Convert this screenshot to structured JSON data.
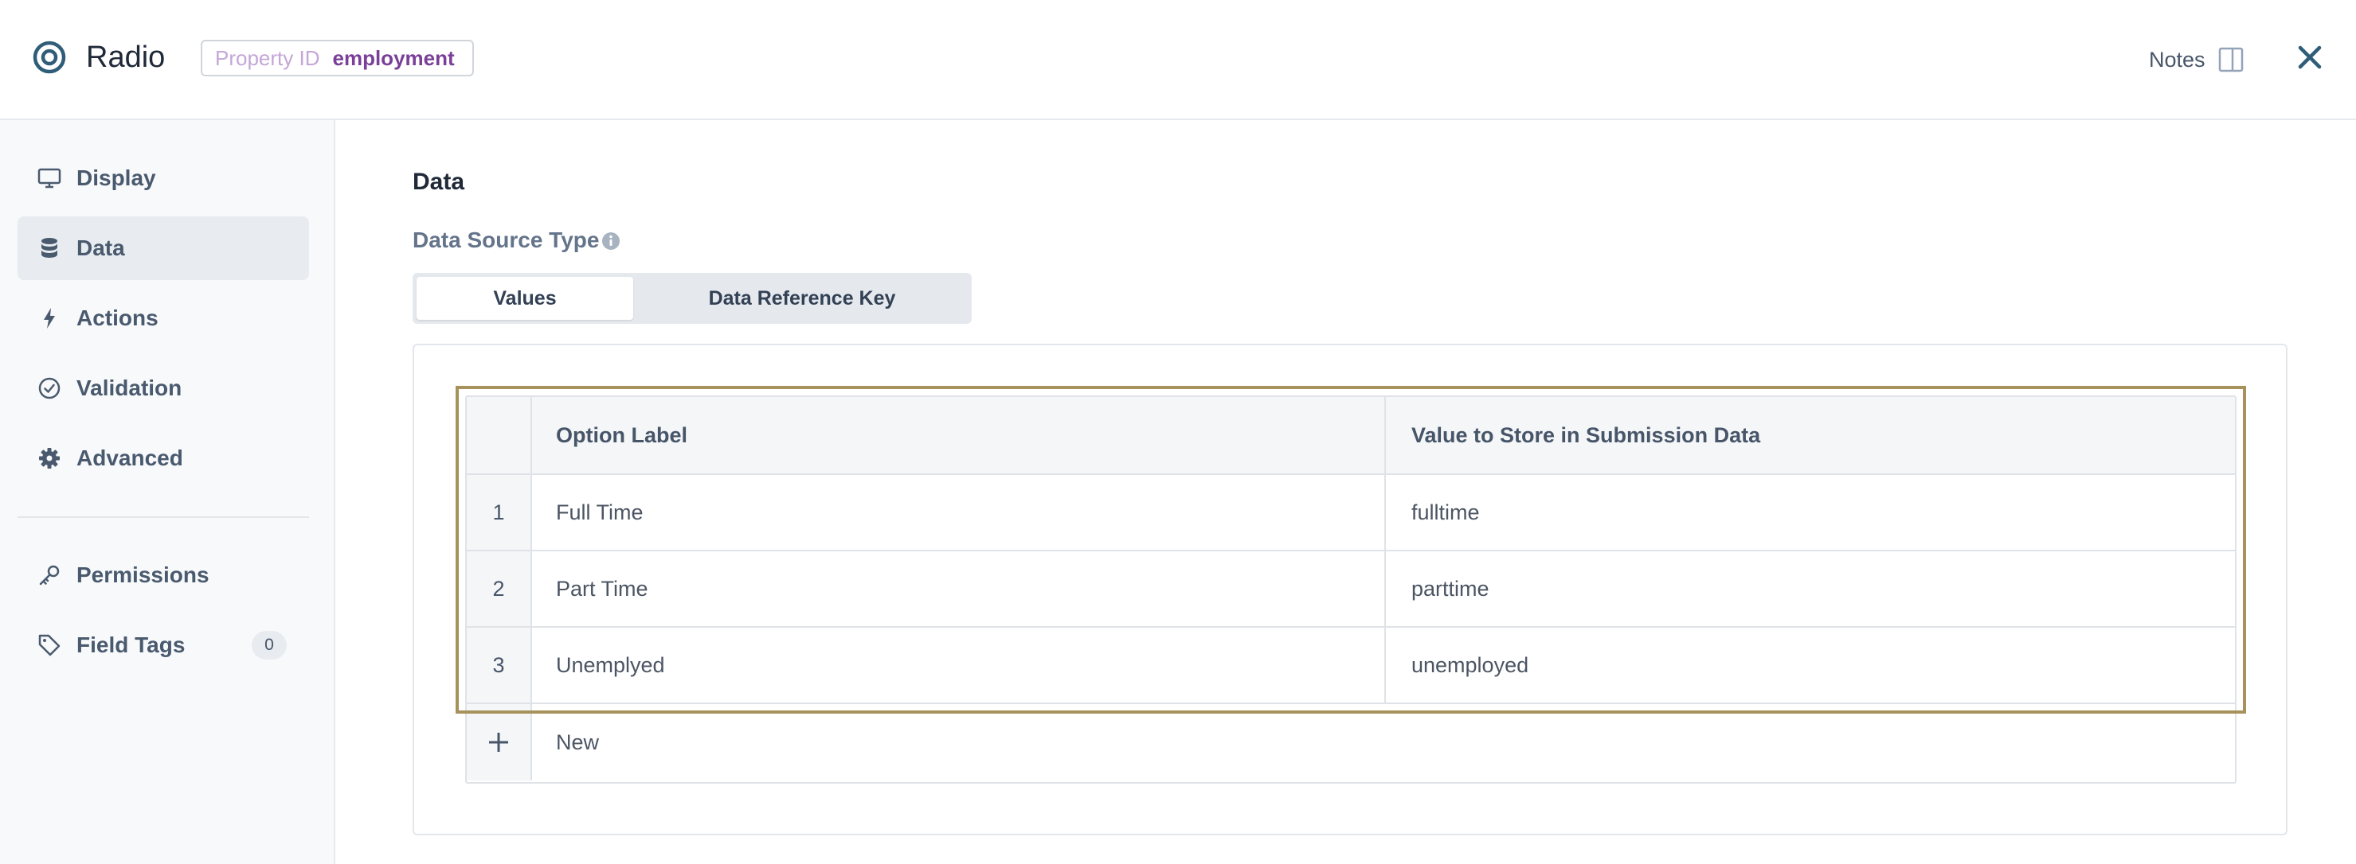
{
  "header": {
    "title": "Radio",
    "property_id_label": "Property ID",
    "property_id_value": "employment",
    "notes_label": "Notes"
  },
  "sidebar": {
    "items": [
      {
        "label": "Display",
        "icon": "monitor-icon"
      },
      {
        "label": "Data",
        "icon": "database-icon",
        "active": true
      },
      {
        "label": "Actions",
        "icon": "lightning-icon"
      },
      {
        "label": "Validation",
        "icon": "check-circle-icon"
      },
      {
        "label": "Advanced",
        "icon": "gear-icon"
      },
      {
        "label": "Permissions",
        "icon": "key-icon"
      },
      {
        "label": "Field Tags",
        "icon": "tag-icon",
        "count": "0"
      }
    ]
  },
  "main": {
    "section_title": "Data",
    "data_source_label": "Data Source Type",
    "segments": [
      {
        "label": "Values",
        "selected": true
      },
      {
        "label": "Data Reference Key",
        "selected": false
      }
    ],
    "table": {
      "headers": [
        "",
        "Option Label",
        "Value to Store in Submission Data"
      ],
      "rows": [
        {
          "num": "1",
          "label": "Full Time",
          "value": "fulltime"
        },
        {
          "num": "2",
          "label": "Part Time",
          "value": "parttime"
        },
        {
          "num": "3",
          "label": "Unemplyed",
          "value": "unemployed"
        }
      ],
      "new_label": "New"
    }
  },
  "colors": {
    "accent_purple": "#7a3f98",
    "active_nav_bg": "#e8ecf0",
    "selection_outline": "#a6925a",
    "icon_teal": "#2f5d78"
  }
}
